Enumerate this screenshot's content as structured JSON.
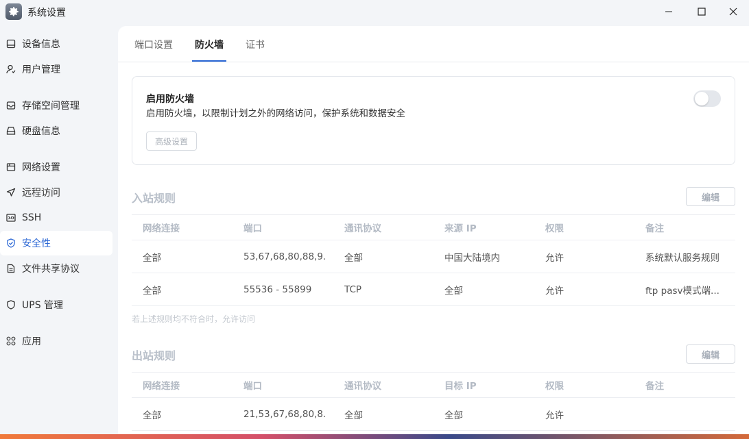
{
  "window": {
    "title": "系统设置",
    "controls": {
      "minimize": "—",
      "maximize": "☐",
      "close": "✕"
    }
  },
  "sidebar": {
    "items": [
      {
        "label": "设备信息",
        "icon": "device-icon"
      },
      {
        "label": "用户管理",
        "icon": "user-icon"
      },
      {
        "label": "存储空间管理",
        "icon": "storage-icon"
      },
      {
        "label": "硬盘信息",
        "icon": "disk-icon"
      },
      {
        "label": "网络设置",
        "icon": "network-icon"
      },
      {
        "label": "远程访问",
        "icon": "remote-icon"
      },
      {
        "label": "SSH",
        "icon": "terminal-icon"
      },
      {
        "label": "安全性",
        "icon": "shield-icon",
        "active": true
      },
      {
        "label": "文件共享协议",
        "icon": "file-icon"
      },
      {
        "label": "UPS 管理",
        "icon": "ups-shield-icon"
      },
      {
        "label": "应用",
        "icon": "apps-icon"
      }
    ]
  },
  "tabs": [
    {
      "label": "端口设置"
    },
    {
      "label": "防火墙",
      "active": true
    },
    {
      "label": "证书"
    }
  ],
  "firewall": {
    "title": "启用防火墙",
    "description": "启用防火墙，以限制计划之外的网络访问，保护系统和数据安全",
    "advanced_label": "高级设置",
    "enabled": false
  },
  "inbound": {
    "title": "入站规则",
    "edit_label": "编辑",
    "columns": [
      "网络连接",
      "端口",
      "通讯协议",
      "来源 IP",
      "权限",
      "备注"
    ],
    "rows": [
      [
        "全部",
        "53,67,68,80,88,9...",
        "全部",
        "中国大陆境内",
        "允许",
        "系统默认服务规则"
      ],
      [
        "全部",
        "55536 - 55899",
        "TCP",
        "全部",
        "允许",
        "ftp pasv模式端..."
      ]
    ],
    "note": "若上述规则均不符合时，允许访问"
  },
  "outbound": {
    "title": "出站规则",
    "edit_label": "编辑",
    "columns": [
      "网络连接",
      "端口",
      "通讯协议",
      "目标 IP",
      "权限",
      "备注"
    ],
    "rows": [
      [
        "全部",
        "21,53,67,68,80,8...",
        "全部",
        "全部",
        "允许",
        ""
      ]
    ]
  },
  "colors": {
    "accent": "#2a66d4",
    "sidebar_bg": "#f3f5f8",
    "panel_bg": "#ffffff"
  }
}
